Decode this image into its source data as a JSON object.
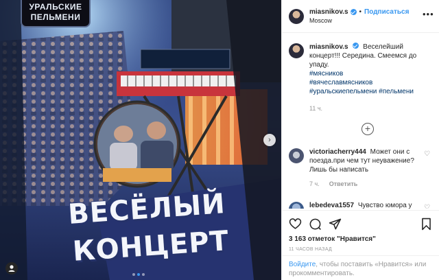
{
  "media": {
    "show_logo_lines": [
      "УРАЛЬСКИЕ",
      "ПЕЛЬМЕНИ"
    ],
    "headline_line1": "ВЕСЁЛЫЙ",
    "headline_line2": "КОНЦЕРТ",
    "slide_count": 3,
    "active_slide": 1,
    "next_arrow_glyph": "›"
  },
  "header": {
    "username": "miasnikov.s",
    "separator": "•",
    "follow_label": "Подписаться",
    "location": "Moscow",
    "more_glyph": "•••"
  },
  "caption": {
    "username": "miasnikov.s",
    "text": "Веселейший концерт!!! Середина. Смеемся до упаду.",
    "hashtags": [
      "#мясников",
      "#вячеславмясников",
      "#уральскиепельмени #пельмени"
    ],
    "time": "11 ч."
  },
  "load_more_glyph": "+",
  "comments": [
    {
      "username": "victoriacherry444",
      "text": "Может они с поезда.при чем тут неуважение? Лишь бы написать",
      "time": "7 ч.",
      "reply_label": "Ответить"
    },
    {
      "username": "lebedeva1557",
      "text": "Чувство юмора у людей нету похоже. Мы вас очень",
      "time": "",
      "reply_label": ""
    }
  ],
  "actions": {
    "likes_text": "3 163 отметок \"Нравится\"",
    "time_ago": "11 ЧАСОВ НАЗАД"
  },
  "footer": {
    "login_link": "Войдите",
    "rest_text": ", чтобы поставить «Нравится» или прокомментировать."
  },
  "colors": {
    "accent": "#3897f0",
    "hashtag": "#003569",
    "muted": "#999999",
    "text": "#262626"
  }
}
